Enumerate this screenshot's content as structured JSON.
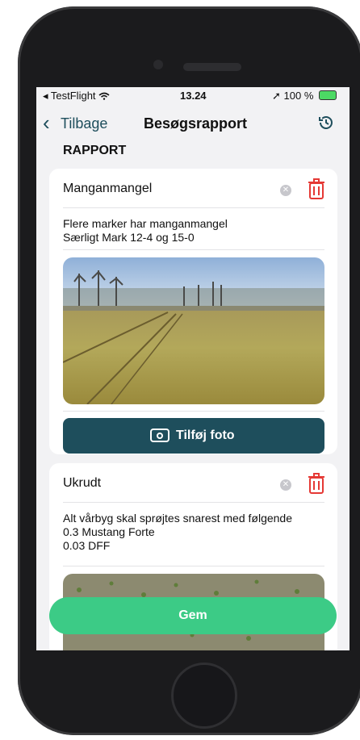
{
  "status_bar": {
    "carrier": "◂ TestFlight",
    "time": "13.24",
    "battery": "100 %"
  },
  "nav": {
    "back_label": "Tilbage",
    "title": "Besøgsrapport"
  },
  "section_title": "RAPPORT",
  "cards": [
    {
      "title": "Manganmangel",
      "lines": [
        "Flere marker har manganmangel",
        "Særligt Mark 12-4 og 15-0"
      ]
    },
    {
      "title": "Ukrudt",
      "lines": [
        "Alt vårbyg skal sprøjtes snarest med følgende",
        "0.3 Mustang Forte",
        "0.03 DFF"
      ]
    }
  ],
  "add_photo_label": "Tilføj foto",
  "save_label": "Gem",
  "colors": {
    "primary": "#1e4e5c",
    "save": "#3ccb86",
    "delete": "#e53935"
  }
}
